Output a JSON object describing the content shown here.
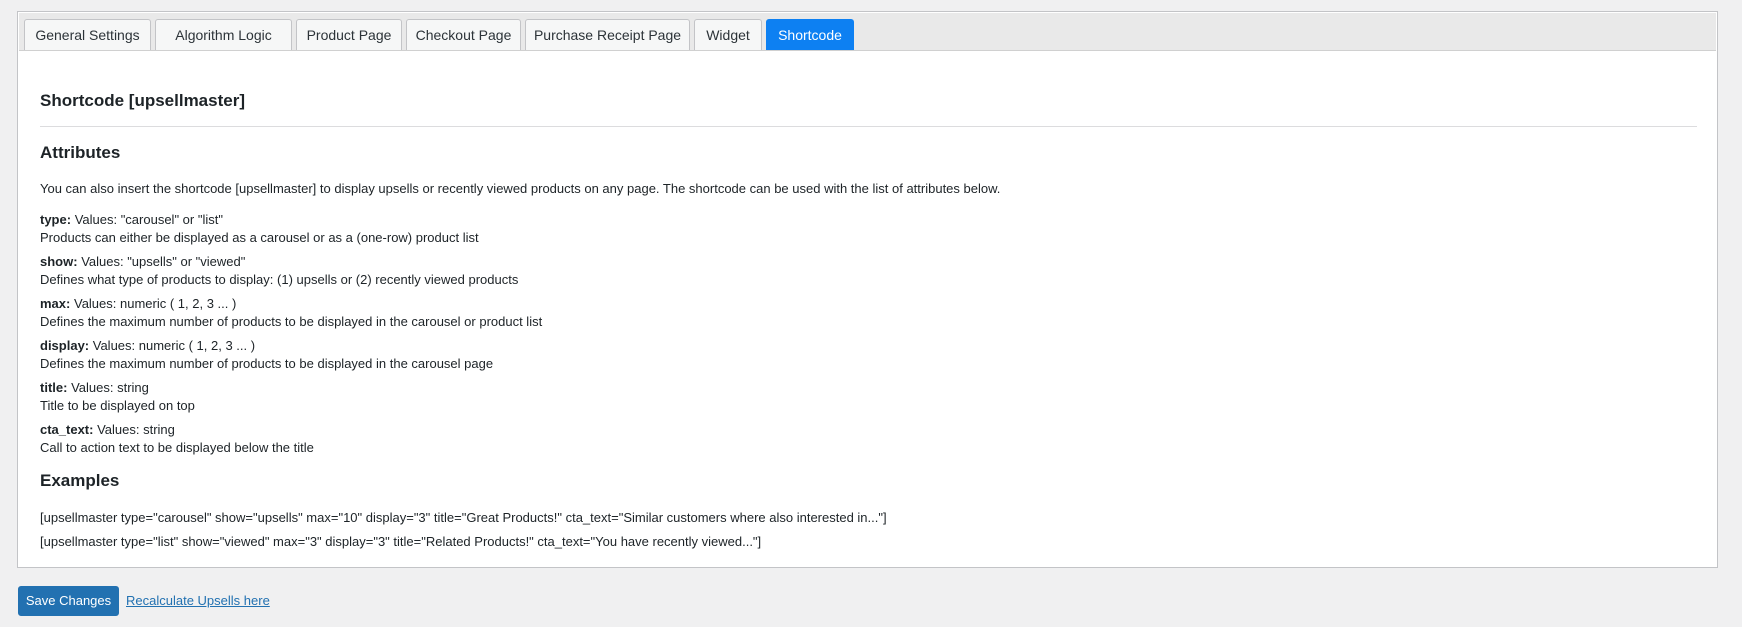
{
  "tabs": [
    {
      "label": "General Settings"
    },
    {
      "label": "Algorithm Logic"
    },
    {
      "label": "Product Page"
    },
    {
      "label": "Checkout Page"
    },
    {
      "label": "Purchase Receipt Page"
    },
    {
      "label": "Widget"
    },
    {
      "label": "Shortcode",
      "active": true
    }
  ],
  "page": {
    "title": "Shortcode [upsellmaster]",
    "attributes_heading": "Attributes",
    "intro": "You can also insert the shortcode [upsellmaster] to display upsells or recently viewed products on any page. The shortcode can be used with the list of attributes below.",
    "attributes": [
      {
        "name": "type:",
        "values": "Values: \"carousel\" or \"list\"",
        "desc": "Products can either be displayed as a carousel or as a (one-row) product list"
      },
      {
        "name": "show:",
        "values": "Values: \"upsells\" or \"viewed\"",
        "desc": "Defines what type of products to display: (1) upsells or (2) recently viewed products"
      },
      {
        "name": "max:",
        "values": "Values: numeric ( 1, 2, 3 ... )",
        "desc": "Defines the maximum number of products to be displayed in the carousel or product list"
      },
      {
        "name": "display:",
        "values": "Values: numeric ( 1, 2, 3 ... )",
        "desc": "Defines the maximum number of products to be displayed in the carousel page"
      },
      {
        "name": "title:",
        "values": "Values: string",
        "desc": "Title to be displayed on top"
      },
      {
        "name": "cta_text:",
        "values": "Values: string",
        "desc": "Call to action text to be displayed below the title"
      }
    ],
    "examples_heading": "Examples",
    "examples": [
      "[upsellmaster type=\"carousel\" show=\"upsells\" max=\"10\" display=\"3\" title=\"Great Products!\" cta_text=\"Similar customers where also interested in...\"]",
      "[upsellmaster type=\"list\" show=\"viewed\" max=\"3\" display=\"3\" title=\"Related Products!\" cta_text=\"You have recently viewed...\"]"
    ]
  },
  "footer": {
    "save_label": "Save Changes",
    "recalc_label": "Recalculate Upsells here"
  },
  "colors": {
    "active_tab": "#0d80f2",
    "primary_button": "#2271b1",
    "link": "#2271b1"
  }
}
